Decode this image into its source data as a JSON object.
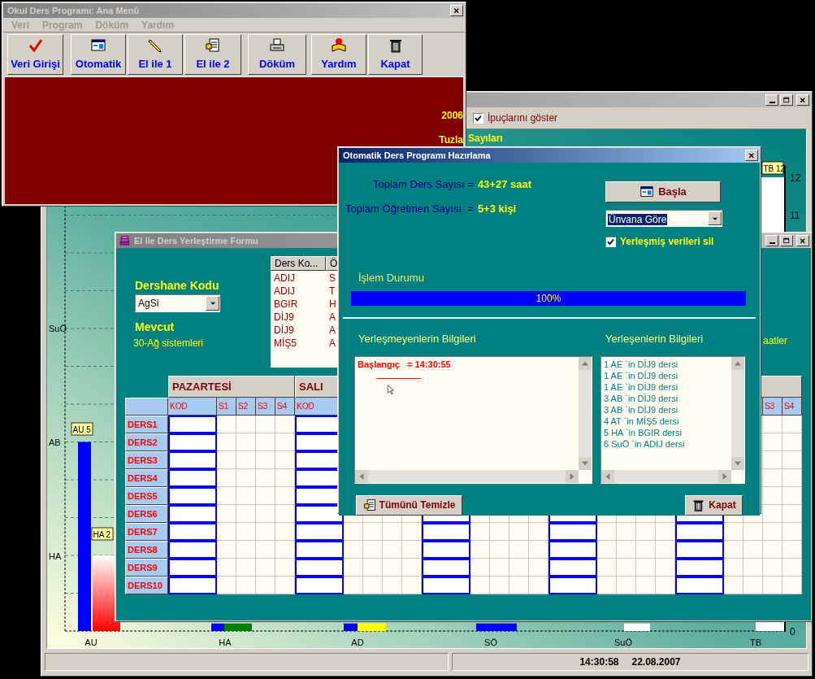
{
  "chart_window": {
    "active": false,
    "show_tips": {
      "label": "İpuçlarını göster",
      "checked": true
    },
    "chart": {
      "title": "Sayıları",
      "bar_labels": [
        "AU 5",
        "HA 2",
        "TB 12"
      ],
      "row_labels": [
        "SuÖ",
        "AB",
        "HA"
      ],
      "scale_labels": [
        "12",
        "11",
        "0"
      ],
      "x_labels": [
        "AU",
        "HA",
        "AD",
        "SÖ",
        "SuÖ",
        "TB"
      ]
    },
    "status_bar": {
      "time": "14:30:58",
      "date": "22.08.2007"
    }
  },
  "main_window": {
    "active": false,
    "title": "Okul Ders Programı: Ana Menü",
    "menu": [
      {
        "label": "Veri",
        "disabled": true
      },
      {
        "label": "Program",
        "disabled": true
      },
      {
        "label": "Döküm",
        "disabled": true
      },
      {
        "label": "Yardım",
        "disabled": true
      }
    ],
    "toolbar": [
      {
        "label": "Veri Girişi",
        "kind": "check"
      },
      {
        "label": "Otomatik",
        "kind": "window"
      },
      {
        "label": "El ile 1",
        "kind": "pencil"
      },
      {
        "label": "El ile 2",
        "kind": "document"
      },
      {
        "label": "Döküm",
        "kind": "printer"
      },
      {
        "label": "Yardım",
        "kind": "book"
      },
      {
        "label": "Kapat",
        "kind": "trash"
      }
    ],
    "banner": [
      "2006",
      "Tuzla"
    ]
  },
  "form_window": {
    "active": false,
    "title": "El ile Ders Yerleştirme Formu",
    "classroom_label": "Dershane Kodu",
    "classroom_value": "AgSi",
    "capacity_label": "Mevcut",
    "capacity_value": "30-Ağ sistemleri",
    "course_list": {
      "columns": [
        "Ders Ko...",
        "Ö"
      ],
      "rows": [
        [
          "ADIJ",
          "S"
        ],
        [
          "ADIJ",
          "T"
        ],
        [
          "BGIR",
          "H"
        ],
        [
          "DİJ9",
          "A"
        ],
        [
          "DİJ9",
          "A"
        ],
        [
          "MİŞ5",
          "A"
        ]
      ]
    },
    "side_text": "aatler",
    "days": [
      {
        "name": "PAZARTESİ",
        "slots": [
          "KOD",
          "S1",
          "S2",
          "S3",
          "S4"
        ]
      },
      {
        "name": "SALI",
        "slots": [
          "KOD"
        ]
      }
    ],
    "last_day_slots": [
      "S3",
      "S4"
    ],
    "periods": [
      "DERS1",
      "DERS2",
      "DERS3",
      "DERS4",
      "DERS5",
      "DERS6",
      "DERS7",
      "DERS8",
      "DERS9",
      "DERS10"
    ]
  },
  "auto_dialog": {
    "active": true,
    "title": "Otomatik Ders Programı Hazırlama",
    "stats": [
      {
        "label": "Toplam Ders Sayısı =",
        "value": "43+27 saat"
      },
      {
        "label": "Toplam Öğretmen Sayısı  =",
        "value": "5+3 kişi"
      }
    ],
    "start_button": "Başla",
    "order_select": "Ünvana Göre",
    "clear_checkbox": {
      "label": "Yerleşmiş verileri sil",
      "checked": true
    },
    "progress": {
      "label": "İşlem Durumu",
      "level": 1,
      "reading": "100%"
    },
    "unplaced": {
      "title": "Yerleşmeyenlerin Bilgileri",
      "lines": [
        "Başlangıç   = 14:30:55"
      ]
    },
    "placed": {
      "title": "Yerleşenlerin Bilgileri",
      "lines": [
        "1 AE `in DİJ9 dersi",
        "1 AE `in DİJ9 dersi",
        "1 AE `in DİJ9 dersi",
        "3 AB `in DİJ9 dersi",
        "3 AB `in DİJ9 dersi",
        "4 AT `in MİŞ5 dersi",
        "5 HA `in BGIR dersi",
        "6 SuÖ `in ADIJ dersi"
      ]
    },
    "clear_button": "Tümünü Temizle",
    "close_button": "Kapat"
  }
}
